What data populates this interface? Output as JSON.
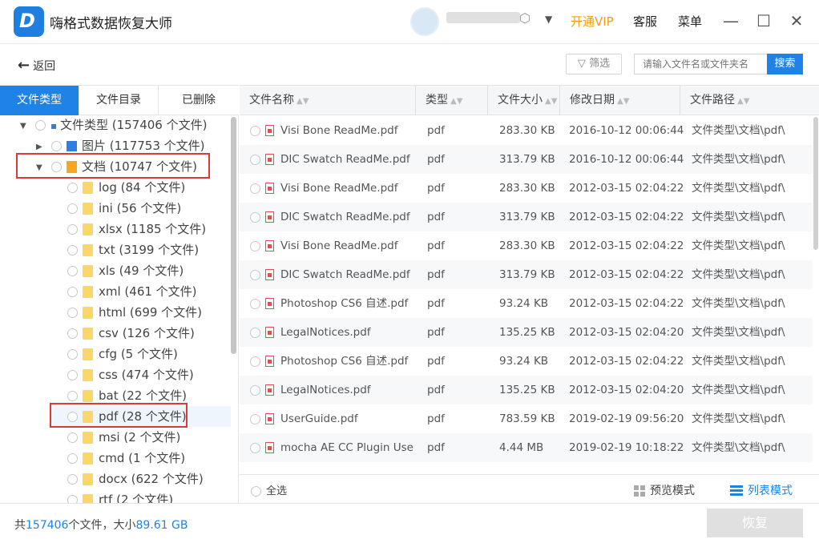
{
  "app": {
    "title": "嗨格式数据恢复大师",
    "vip": "开通VIP",
    "service": "客服",
    "menu": "菜单"
  },
  "toolbar": {
    "back": "返回",
    "filter": "筛选",
    "search_placeholder": "请输入文件名或文件夹名",
    "search_button": "搜索"
  },
  "tabs": [
    "文件类型",
    "文件目录",
    "已删除"
  ],
  "tree": {
    "root": "文件类型 (157406 个文件)",
    "images": "图片 (117753 个文件)",
    "docs": "文档 (10747 个文件)",
    "children": [
      "log (84 个文件)",
      "ini (56 个文件)",
      "xlsx (1185 个文件)",
      "txt (3199 个文件)",
      "xls (49 个文件)",
      "xml (461 个文件)",
      "html (699 个文件)",
      "csv (126 个文件)",
      "cfg (5 个文件)",
      "css (474 个文件)",
      "bat (22 个文件)",
      "pdf (28 个文件)",
      "msi (2 个文件)",
      "cmd (1 个文件)",
      "docx (622 个文件)",
      "rtf (2 个文件)"
    ]
  },
  "columns": [
    "文件名称",
    "类型",
    "文件大小",
    "修改日期",
    "文件路径"
  ],
  "rows": [
    {
      "name": "Visi Bone ReadMe.pdf",
      "type": "pdf",
      "size": "283.30 KB",
      "date": "2016-10-12 00:06:44",
      "path": "文件类型\\文档\\pdf\\"
    },
    {
      "name": "DIC Swatch ReadMe.pdf",
      "type": "pdf",
      "size": "313.79 KB",
      "date": "2016-10-12 00:06:44",
      "path": "文件类型\\文档\\pdf\\"
    },
    {
      "name": "Visi Bone ReadMe.pdf",
      "type": "pdf",
      "size": "283.30 KB",
      "date": "2012-03-15 02:04:22",
      "path": "文件类型\\文档\\pdf\\"
    },
    {
      "name": "DIC Swatch ReadMe.pdf",
      "type": "pdf",
      "size": "313.79 KB",
      "date": "2012-03-15 02:04:22",
      "path": "文件类型\\文档\\pdf\\"
    },
    {
      "name": "Visi Bone ReadMe.pdf",
      "type": "pdf",
      "size": "283.30 KB",
      "date": "2012-03-15 02:04:22",
      "path": "文件类型\\文档\\pdf\\"
    },
    {
      "name": "DIC Swatch ReadMe.pdf",
      "type": "pdf",
      "size": "313.79 KB",
      "date": "2012-03-15 02:04:22",
      "path": "文件类型\\文档\\pdf\\"
    },
    {
      "name": "Photoshop CS6 自述.pdf",
      "type": "pdf",
      "size": "93.24 KB",
      "date": "2012-03-15 02:04:22",
      "path": "文件类型\\文档\\pdf\\"
    },
    {
      "name": "LegalNotices.pdf",
      "type": "pdf",
      "size": "135.25 KB",
      "date": "2012-03-15 02:04:20",
      "path": "文件类型\\文档\\pdf\\"
    },
    {
      "name": "Photoshop CS6 自述.pdf",
      "type": "pdf",
      "size": "93.24 KB",
      "date": "2012-03-15 02:04:22",
      "path": "文件类型\\文档\\pdf\\"
    },
    {
      "name": "LegalNotices.pdf",
      "type": "pdf",
      "size": "135.25 KB",
      "date": "2012-03-15 02:04:20",
      "path": "文件类型\\文档\\pdf\\"
    },
    {
      "name": "UserGuide.pdf",
      "type": "pdf",
      "size": "783.59 KB",
      "date": "2019-02-19 09:56:20",
      "path": "文件类型\\文档\\pdf\\"
    },
    {
      "name": "mocha AE CC Plugin User...",
      "type": "pdf",
      "size": "4.44 MB",
      "date": "2019-02-19 10:18:22",
      "path": "文件类型\\文档\\pdf\\"
    }
  ],
  "bottom": {
    "select_all": "全选",
    "preview_mode": "预览模式",
    "list_mode": "列表模式"
  },
  "footer": {
    "prefix": "共",
    "count": "157406",
    "mid": "个文件，大小",
    "size": "89.61 GB",
    "recover": "恢复"
  }
}
